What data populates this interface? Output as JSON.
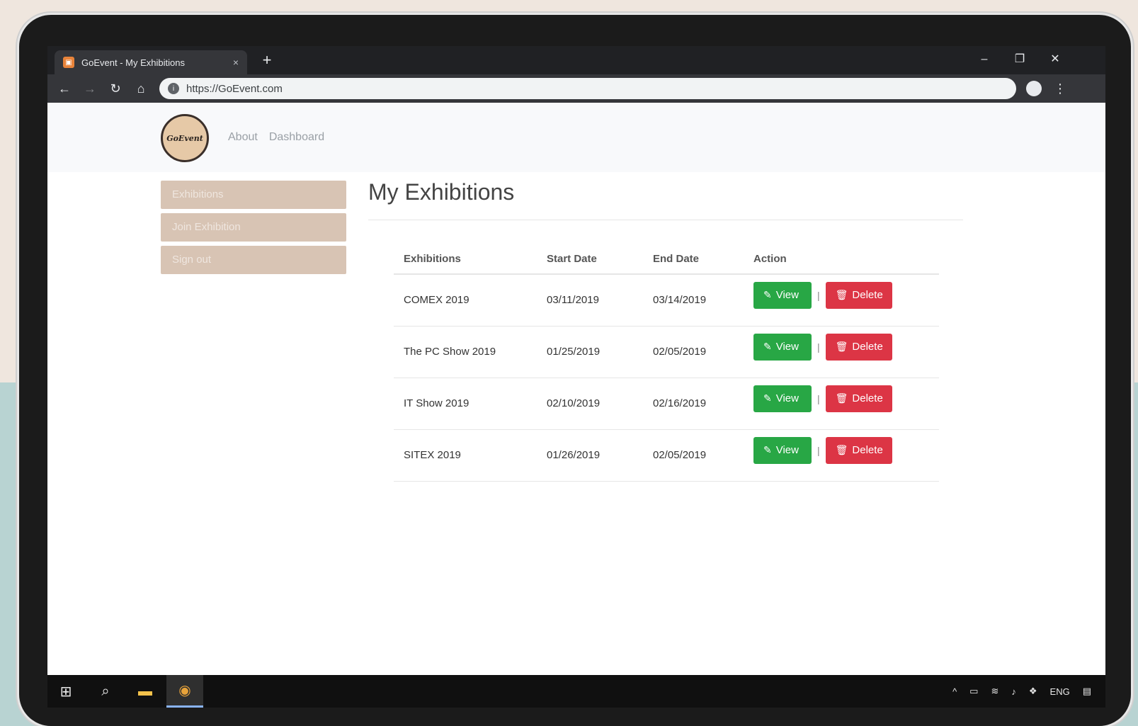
{
  "browser": {
    "tab_title": "GoEvent - My Exhibitions",
    "tab_close": "×",
    "new_tab": "+",
    "url": "https://GoEvent.com",
    "window_controls": {
      "minimize": "–",
      "restore": "❐",
      "close": "✕"
    },
    "nav": {
      "back": "←",
      "forward": "→",
      "reload": "↻",
      "home": "⌂"
    },
    "menu": "⋮"
  },
  "header": {
    "logo_text": "GoEvent",
    "nav": [
      "About",
      "Dashboard"
    ]
  },
  "sidebar": {
    "items": [
      "Exhibitions",
      "Join Exhibition",
      "Sign out"
    ]
  },
  "main": {
    "title": "My Exhibitions",
    "table": {
      "headers": [
        "Exhibitions",
        "Start Date",
        "End Date",
        "Action"
      ],
      "rows": [
        {
          "name": "COMEX 2019",
          "start": "03/11/2019",
          "end": "03/14/2019"
        },
        {
          "name": "The PC Show 2019",
          "start": "01/25/2019",
          "end": "02/05/2019"
        },
        {
          "name": "IT Show 2019",
          "start": "02/10/2019",
          "end": "02/16/2019"
        },
        {
          "name": "SITEX 2019",
          "start": "01/26/2019",
          "end": "02/05/2019"
        }
      ],
      "view_label": "View",
      "delete_label": "Delete",
      "separator": "|"
    }
  },
  "taskbar": {
    "tray_lang": "ENG"
  },
  "colors": {
    "view": "#28a745",
    "delete": "#dc3545",
    "sidebar": "#d8c4b4"
  }
}
